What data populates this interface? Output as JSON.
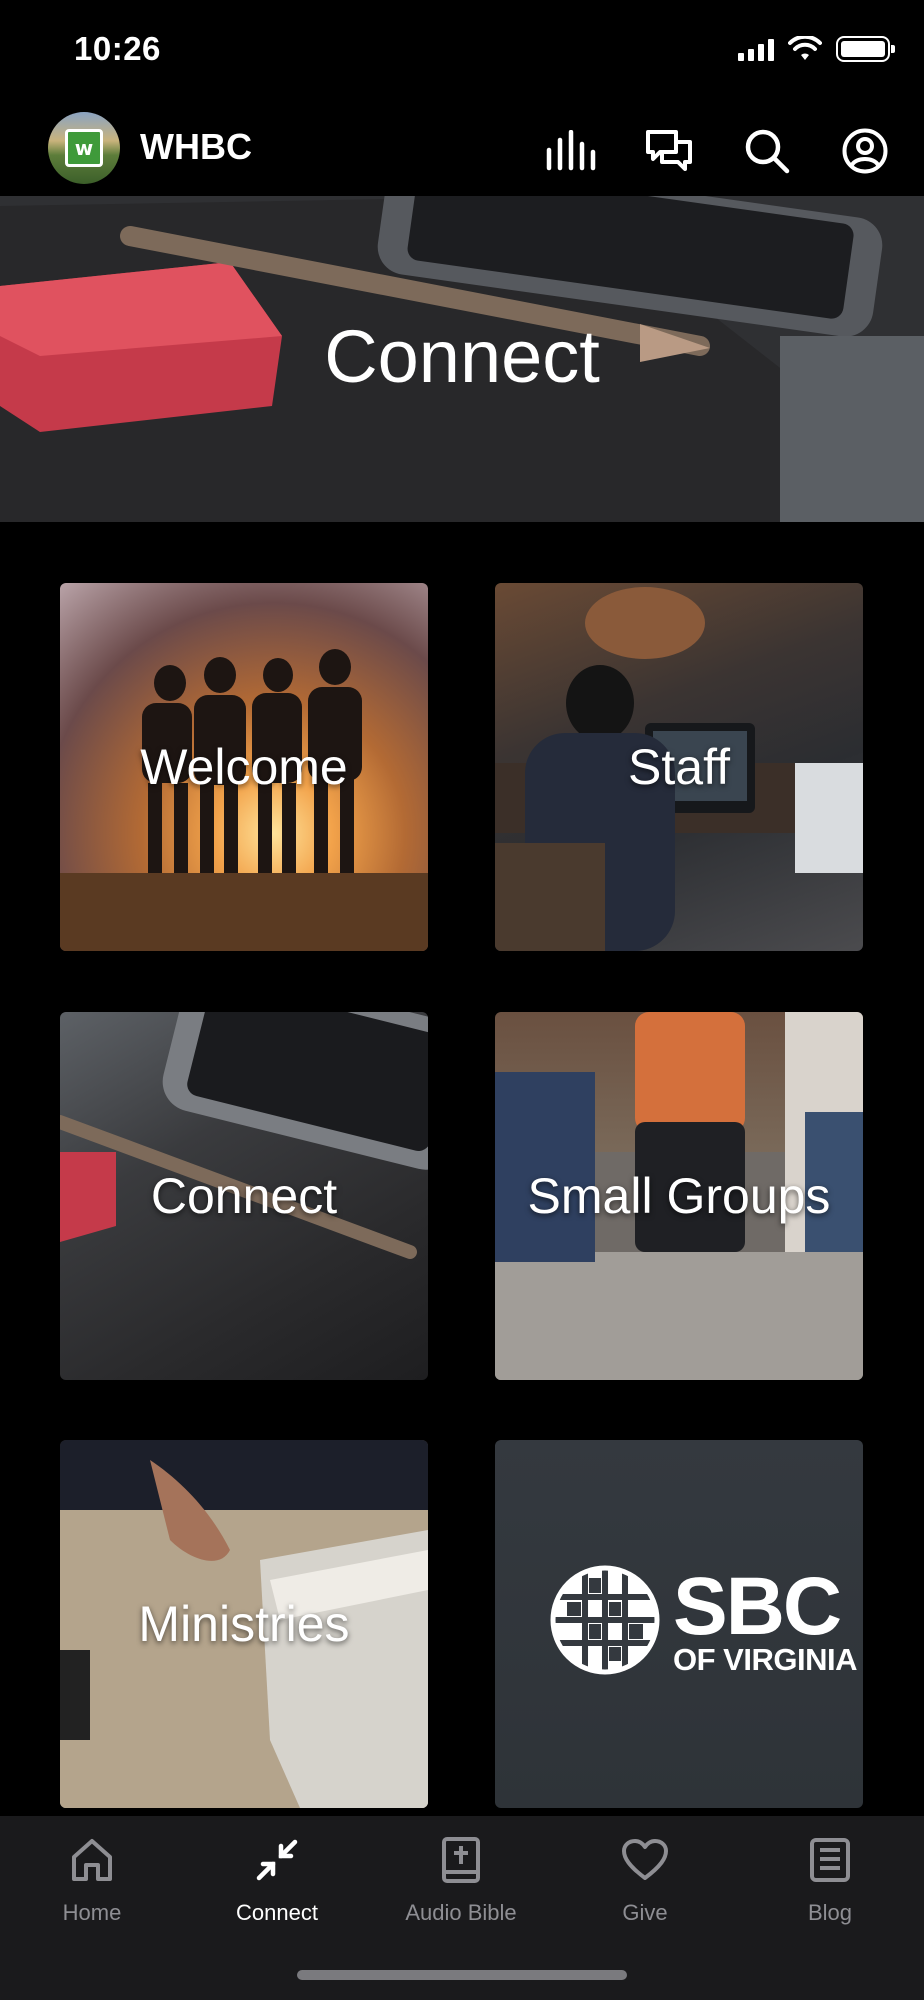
{
  "status": {
    "time": "10:26"
  },
  "header": {
    "app_name": "WHBC",
    "logo_letter": "w"
  },
  "hero": {
    "title": "Connect"
  },
  "tiles": [
    {
      "label": "Welcome"
    },
    {
      "label": "Staff"
    },
    {
      "label": "Connect"
    },
    {
      "label": "Small Groups"
    },
    {
      "label": "Ministries"
    },
    {
      "label": "",
      "logo_big": "SBC",
      "logo_small": "OF VIRGINIA"
    }
  ],
  "tabbar": {
    "items": [
      {
        "label": "Home",
        "icon": "home-icon"
      },
      {
        "label": "Connect",
        "icon": "connect-icon",
        "active": true
      },
      {
        "label": "Audio Bible",
        "icon": "bible-icon"
      },
      {
        "label": "Give",
        "icon": "heart-icon"
      },
      {
        "label": "Blog",
        "icon": "blog-icon"
      }
    ]
  },
  "colors": {
    "background": "#000000",
    "tab_bar": "#1a1a1c",
    "active": "#ffffff",
    "inactive": "#8e8e93"
  }
}
